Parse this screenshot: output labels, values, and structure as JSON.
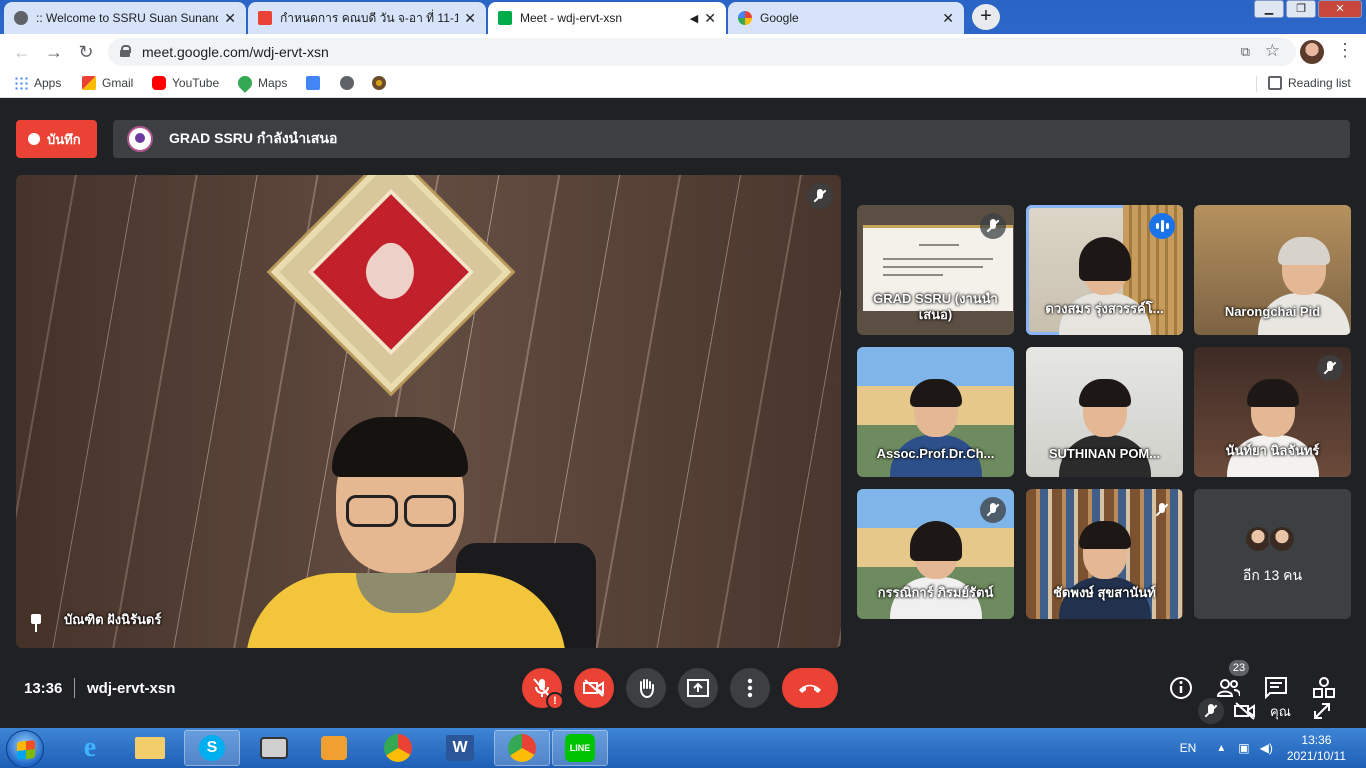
{
  "browser": {
    "tabs": [
      {
        "title": ":: Welcome to SSRU Suan Sunand",
        "active": false
      },
      {
        "title": "กำหนดการ คณบดี วัน จ-อา ที่ 11-17",
        "active": false
      },
      {
        "title": "Meet - wdj-ervt-xsn",
        "active": true
      },
      {
        "title": "Google",
        "active": false
      }
    ],
    "new_tab_label": "+",
    "url": "meet.google.com/wdj-ervt-xsn",
    "bookmarks": [
      "Apps",
      "Gmail",
      "YouTube",
      "Maps"
    ],
    "reading_list": "Reading list"
  },
  "meet": {
    "record_label": "บันทึก",
    "presenting_label": "GRAD SSRU กำลังนำเสนอ",
    "main_speaker": "บัณฑิต ฝังนิรันดร์",
    "participants": [
      {
        "name": "GRAD SSRU (งานนำเสนอ)"
      },
      {
        "name": "ดวงสมร รุ่งสวรรค์โ..."
      },
      {
        "name": "Narongchai Pid"
      },
      {
        "name": "Assoc.Prof.Dr.Ch..."
      },
      {
        "name": "SUTHINAN POM..."
      },
      {
        "name": "นันท์ยา นิลจันทร์"
      },
      {
        "name": "กรรณิการ์ ภิรมย์รัตน์"
      },
      {
        "name": "ชัดพงษ์ สุขสานันท์"
      }
    ],
    "more_label": "อีก 13 คน",
    "self_label": "คุณ",
    "clock": "13:36",
    "meeting_code": "wdj-ervt-xsn",
    "participant_count": "23",
    "colors": {
      "danger": "#ea4335",
      "accent": "#1a73e8",
      "surface": "#202124"
    }
  },
  "taskbar": {
    "lang": "EN",
    "time": "13:36",
    "date": "2021/10/11"
  }
}
